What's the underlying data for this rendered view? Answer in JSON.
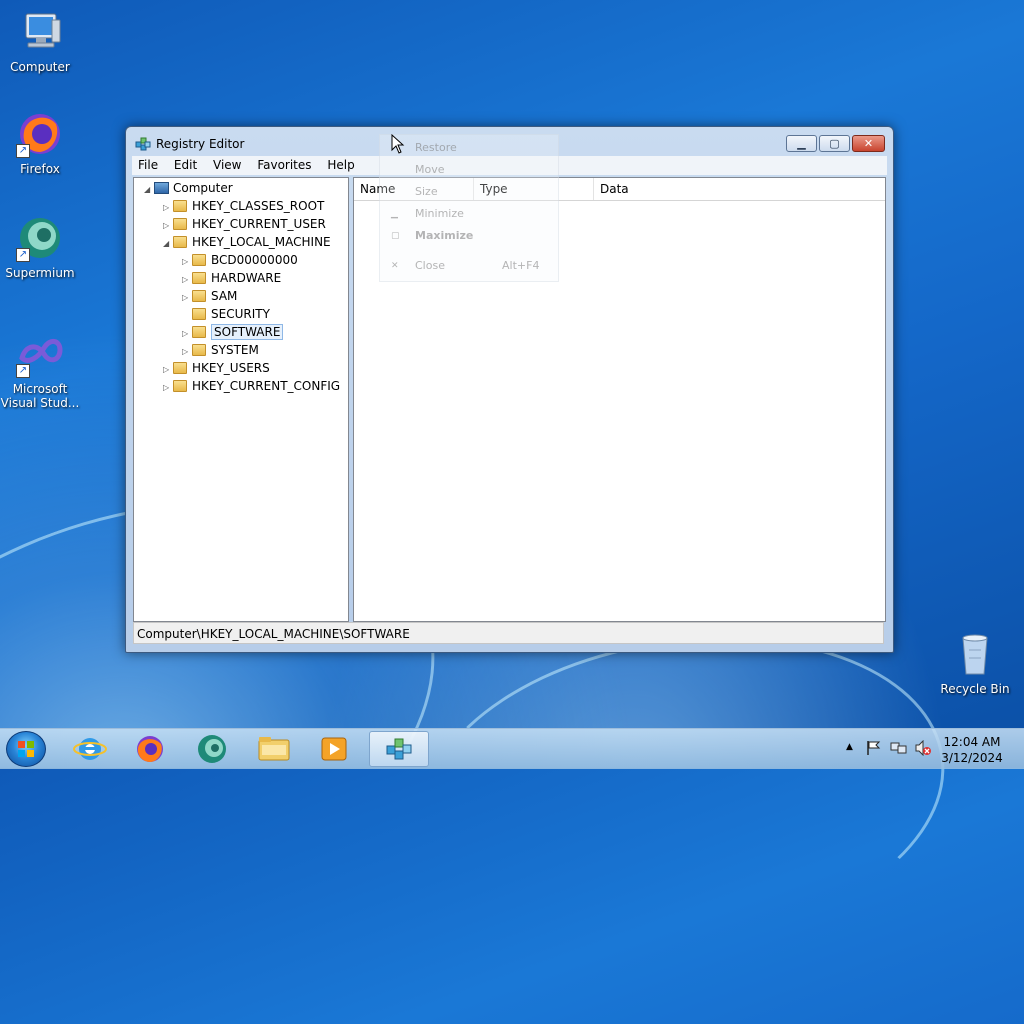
{
  "desktop": {
    "icons": [
      {
        "label": "Computer"
      },
      {
        "label": "Firefox"
      },
      {
        "label": "Supermium"
      },
      {
        "label": "Microsoft Visual Stud..."
      },
      {
        "label": "Recycle Bin"
      }
    ]
  },
  "window": {
    "title": "Registry Editor",
    "controls": {
      "minimize": "▁",
      "maximize": "▢",
      "close": "✕"
    },
    "menu": [
      "File",
      "Edit",
      "View",
      "Favorites",
      "Help"
    ],
    "tree": {
      "root": "Computer",
      "items": [
        {
          "label": "HKEY_CLASSES_ROOT"
        },
        {
          "label": "HKEY_CURRENT_USER"
        },
        {
          "label": "HKEY_LOCAL_MACHINE"
        },
        {
          "label": "BCD00000000"
        },
        {
          "label": "HARDWARE"
        },
        {
          "label": "SAM"
        },
        {
          "label": "SECURITY"
        },
        {
          "label": "SOFTWARE"
        },
        {
          "label": "SYSTEM"
        },
        {
          "label": "HKEY_USERS"
        },
        {
          "label": "HKEY_CURRENT_CONFIG"
        }
      ]
    },
    "list": {
      "columns": [
        "Name",
        "Type",
        "Data"
      ]
    },
    "status": "Computer\\HKEY_LOCAL_MACHINE\\SOFTWARE"
  },
  "system_menu": {
    "items": [
      {
        "label": "Restore"
      },
      {
        "label": "Move"
      },
      {
        "label": "Size"
      },
      {
        "label": "Minimize"
      },
      {
        "label": "Maximize"
      },
      {
        "label": "Close",
        "shortcut": "Alt+F4"
      }
    ]
  },
  "taskbar": {
    "clock_time": "12:04 AM",
    "clock_date": "3/12/2024",
    "tray_arrow": "▲"
  },
  "colors": {
    "accent": "#1a78d6",
    "selection": "#e6f0fb",
    "close_button": "#c8442f"
  }
}
